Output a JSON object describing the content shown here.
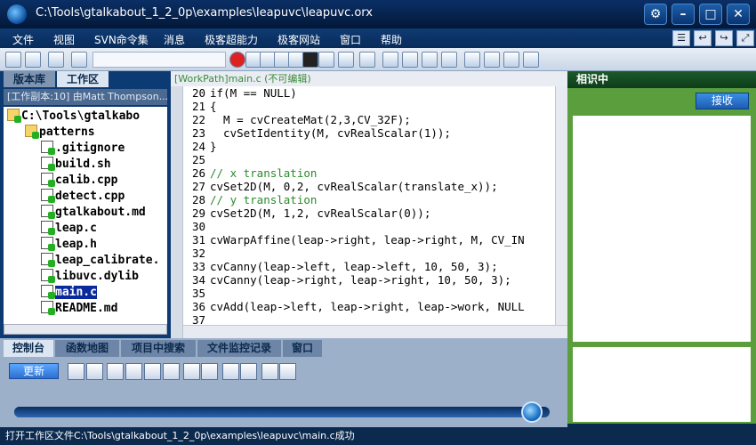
{
  "window": {
    "title": "C:\\Tools\\gtalkabout_1_2_0p\\examples\\leapuvc\\leapuvc.orx"
  },
  "menubar": [
    "文件",
    "视图",
    "SVN命令集",
    "消息",
    "极客超能力",
    "极客网站",
    "窗口",
    "帮助"
  ],
  "left_panel": {
    "tabs": [
      "版本库",
      "工作区"
    ],
    "active_tab": "工作区",
    "workcopy_label": "[工作副本:10] 由Matt Thompson...",
    "tree": {
      "root": "C:\\Tools\\gtalkabo",
      "items": [
        "patterns",
        ".gitignore",
        "build.sh",
        "calib.cpp",
        "detect.cpp",
        "gtalkabout.md",
        "leap.c",
        "leap.h",
        "leap_calibrate.",
        "libuvc.dylib",
        "main.c",
        "README.md"
      ],
      "selected": "main.c"
    }
  },
  "editor": {
    "header": "[WorkPath]main.c (不可编辑)",
    "lines": [
      {
        "n": "20",
        "code": "if(M == NULL)"
      },
      {
        "n": "21",
        "code": "{"
      },
      {
        "n": "22",
        "code": "  M = cvCreateMat(2,3,CV_32F);"
      },
      {
        "n": "23",
        "code": "  cvSetIdentity(M, cvRealScalar(1));"
      },
      {
        "n": "24",
        "code": "}"
      },
      {
        "n": "25",
        "code": ""
      },
      {
        "n": "26",
        "code": "// x translation"
      },
      {
        "n": "27",
        "code": "cvSet2D(M, 0,2, cvRealScalar(translate_x));"
      },
      {
        "n": "28",
        "code": "// y translation"
      },
      {
        "n": "29",
        "code": "cvSet2D(M, 1,2, cvRealScalar(0));"
      },
      {
        "n": "30",
        "code": ""
      },
      {
        "n": "31",
        "code": "cvWarpAffine(leap->right, leap->right, M, CV_IN"
      },
      {
        "n": "32",
        "code": ""
      },
      {
        "n": "33",
        "code": "cvCanny(leap->left, leap->left, 10, 50, 3);"
      },
      {
        "n": "34",
        "code": "cvCanny(leap->right, leap->right, 10, 50, 3);"
      },
      {
        "n": "35",
        "code": ""
      },
      {
        "n": "36",
        "code": "cvAdd(leap->left, leap->right, leap->work, NULL"
      },
      {
        "n": "37",
        "code": ""
      }
    ]
  },
  "right_panel": {
    "title": "相识中",
    "receive_button": "接收"
  },
  "bottom_panel": {
    "tabs": [
      "控制台",
      "函数地图",
      "项目中搜索",
      "文件监控记录",
      "窗口"
    ],
    "active_tab": "控制台",
    "update_button": "更新",
    "progress": 0.97
  },
  "statusbar": {
    "text": "打开工作区文件C:\\Tools\\gtalkabout_1_2_0p\\examples\\leapuvc\\main.c成功"
  },
  "colors": {
    "titlebar": "#0a2f66",
    "accent_green": "#5a9e3e",
    "selection": "#0a2a9c"
  }
}
